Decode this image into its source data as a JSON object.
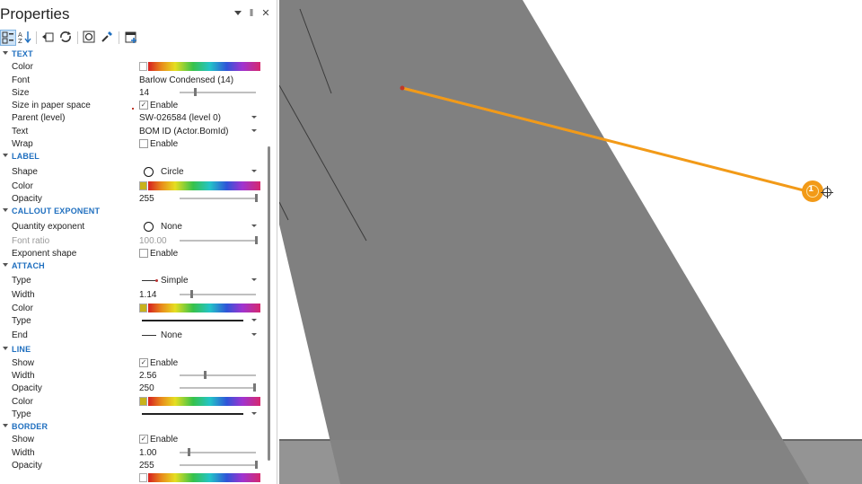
{
  "panel": {
    "title": "Properties",
    "controls": {
      "dropdown_icon": "chevron-down-icon",
      "pin_icon": "pin-icon",
      "close_icon": "close-icon",
      "pin_glyph": "‖",
      "close_glyph": "✕"
    }
  },
  "toolbar": {
    "icons": [
      "categorized-view-icon",
      "sort-alphabetical-icon",
      "pick-properties-icon",
      "refresh-properties-icon",
      "reset-icon",
      "eyedropper-icon",
      "add-property-icon"
    ]
  },
  "sections": {
    "text": {
      "header": "TEXT",
      "color_label": "Color",
      "font_label": "Font",
      "font_value": "Barlow Condensed (14)",
      "size_label": "Size",
      "size_value": "14",
      "size_fraction": 0.2,
      "paper_label": "Size in paper space",
      "paper_value": "Enable",
      "paper_checked": true,
      "parent_label": "Parent (level)",
      "parent_value": "SW-026584 (level 0)",
      "text_label": "Text",
      "text_value": "BOM ID (Actor.BomId)",
      "wrap_label": "Wrap",
      "wrap_value": "Enable",
      "wrap_checked": false
    },
    "label": {
      "header": "LABEL",
      "shape_label": "Shape",
      "shape_value": "Circle",
      "color_label": "Color",
      "swatch_color": "#c8b21c",
      "opacity_label": "Opacity",
      "opacity_value": "255",
      "opacity_fraction": 1.0
    },
    "callout_exponent": {
      "header": "CALLOUT EXPONENT",
      "qty_label": "Quantity exponent",
      "qty_value": "None",
      "ratio_label": "Font ratio",
      "ratio_value": "100.00",
      "ratio_fraction": 1.0,
      "shape_label": "Exponent shape",
      "shape_value": "Enable",
      "shape_checked": false
    },
    "attach": {
      "header": "ATTACH",
      "type_label": "Type",
      "type_value": "Simple",
      "width_label": "Width",
      "width_value": "1.14",
      "width_fraction": 0.15,
      "color_label": "Color",
      "swatch_color": "#c8b21c",
      "linetype_label": "Type",
      "end_label": "End",
      "end_value": "None"
    },
    "line": {
      "header": "LINE",
      "show_label": "Show",
      "show_value": "Enable",
      "show_checked": true,
      "width_label": "Width",
      "width_value": "2.56",
      "width_fraction": 0.33,
      "opacity_label": "Opacity",
      "opacity_value": "250",
      "opacity_fraction": 0.98,
      "color_label": "Color",
      "swatch_color": "#c8b21c",
      "linetype_label": "Type"
    },
    "border": {
      "header": "BORDER",
      "show_label": "Show",
      "show_value": "Enable",
      "show_checked": true,
      "width_label": "Width",
      "width_value": "1.00",
      "width_fraction": 0.12,
      "opacity_label": "Opacity",
      "opacity_value": "255",
      "opacity_fraction": 1.0
    }
  },
  "viewport": {
    "callout_color": "#f29a18",
    "part_color": "#808080",
    "callout_glyph": "1"
  }
}
